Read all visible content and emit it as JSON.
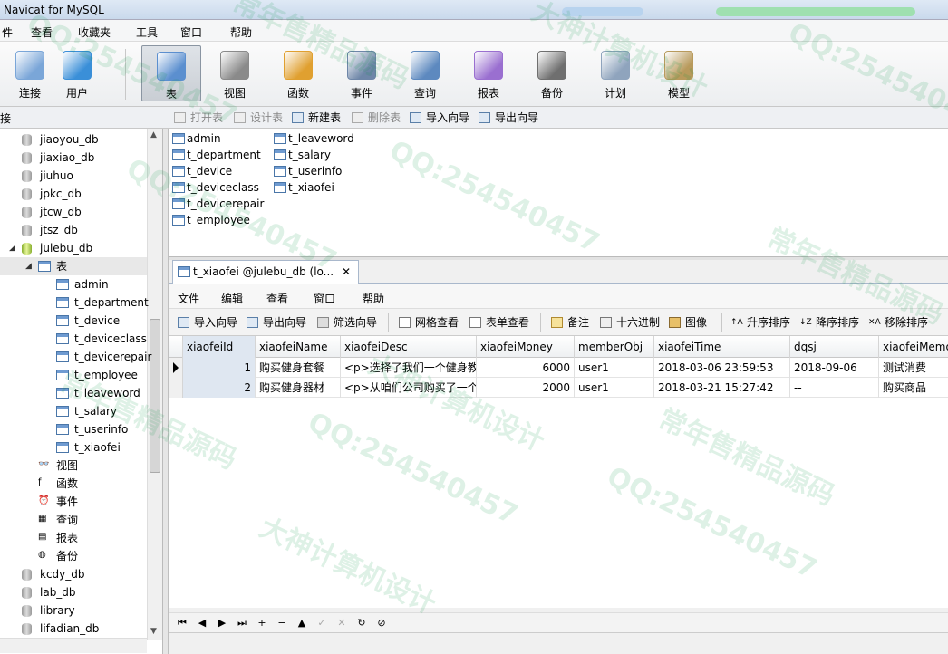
{
  "window": {
    "title": "Navicat for MySQL"
  },
  "menu": [
    "件",
    "查看",
    "收藏夹",
    "工具",
    "窗口",
    "帮助"
  ],
  "toolbar": [
    {
      "label": "连接",
      "icon": "connection-icon",
      "color": "#7aa6d8",
      "active": false
    },
    {
      "label": "用户",
      "icon": "user-icon",
      "color": "#3a8fd8",
      "active": false
    },
    {
      "label": "表",
      "icon": "table-icon",
      "color": "#5b8fcf",
      "active": true
    },
    {
      "label": "视图",
      "icon": "view-icon",
      "color": "#8a8a8a",
      "active": false
    },
    {
      "label": "函数",
      "icon": "function-icon",
      "color": "#e0a030",
      "active": false
    },
    {
      "label": "事件",
      "icon": "event-icon",
      "color": "#6e86a8",
      "active": false
    },
    {
      "label": "查询",
      "icon": "query-icon",
      "color": "#5d89bf",
      "active": false
    },
    {
      "label": "报表",
      "icon": "report-icon",
      "color": "#9a6fd0",
      "active": false
    },
    {
      "label": "备份",
      "icon": "backup-icon",
      "color": "#6f6f6f",
      "active": false
    },
    {
      "label": "计划",
      "icon": "schedule-icon",
      "color": "#8fa4bd",
      "active": false
    },
    {
      "label": "模型",
      "icon": "model-icon",
      "color": "#b89a5c",
      "active": false
    }
  ],
  "connection_header": "接",
  "object_toolbar": [
    {
      "label": "打开表",
      "disabled": true
    },
    {
      "label": "设计表",
      "disabled": true
    },
    {
      "label": "新建表",
      "disabled": false
    },
    {
      "label": "删除表",
      "disabled": true
    },
    {
      "label": "导入向导",
      "disabled": false
    },
    {
      "label": "导出向导",
      "disabled": false
    }
  ],
  "tree": {
    "databases_top": [
      "jiaoyou_db",
      "jiaxiao_db",
      "jiuhuo",
      "jpkc_db",
      "jtcw_db",
      "jtsz_db"
    ],
    "open_db": "julebu_db",
    "tables_folder": "表",
    "tables": [
      "admin",
      "t_department",
      "t_device",
      "t_deviceclass",
      "t_devicerepair",
      "t_employee",
      "t_leaveword",
      "t_salary",
      "t_userinfo",
      "t_xiaofei"
    ],
    "folders": [
      {
        "label": "视图",
        "icon": "view-icon"
      },
      {
        "label": "函数",
        "icon": "function-icon"
      },
      {
        "label": "事件",
        "icon": "event-icon"
      },
      {
        "label": "查询",
        "icon": "query-icon"
      },
      {
        "label": "报表",
        "icon": "report-icon"
      },
      {
        "label": "备份",
        "icon": "backup-icon"
      }
    ],
    "databases_bottom": [
      "kcdy_db",
      "lab_db",
      "library",
      "lifadian_db"
    ]
  },
  "object_list": {
    "col1": [
      "admin",
      "t_department",
      "t_device",
      "t_deviceclass",
      "t_devicerepair",
      "t_employee"
    ],
    "col2": [
      "t_leaveword",
      "t_salary",
      "t_userinfo",
      "t_xiaofei"
    ]
  },
  "tab": {
    "label": "t_xiaofei @julebu_db (lo...",
    "close": "✕"
  },
  "editor_menu": [
    "文件",
    "编辑",
    "查看",
    "窗口",
    "帮助"
  ],
  "editor_toolbar": [
    "导入向导",
    "导出向导",
    "筛选向导",
    "网格查看",
    "表单查看",
    "备注",
    "十六进制",
    "图像",
    "升序排序",
    "降序排序",
    "移除排序"
  ],
  "grid": {
    "columns": [
      "xiaofeiId",
      "xiaofeiName",
      "xiaofeiDesc",
      "xiaofeiMoney",
      "memberObj",
      "xiaofeiTime",
      "dqsj",
      "xiaofeiMemo"
    ],
    "rows": [
      [
        "1",
        "购买健身套餐",
        "<p>选择了我们一个健身教",
        "6000",
        "user1",
        "2018-03-06 23:59:53",
        "2018-09-06",
        "测试消费"
      ],
      [
        "2",
        "购买健身器材",
        "<p>从咱们公司购买了一个",
        "2000",
        "user1",
        "2018-03-21 15:27:42",
        "--",
        "购买商品"
      ]
    ]
  },
  "navigator": [
    "⏮",
    "◀",
    "▶",
    "⏭",
    "+",
    "−",
    "▲",
    "✓",
    "✕",
    "↻",
    "⊘"
  ],
  "watermarks": [
    "QQ:254540457",
    "大神计算机设计",
    "常年售精品源码"
  ]
}
